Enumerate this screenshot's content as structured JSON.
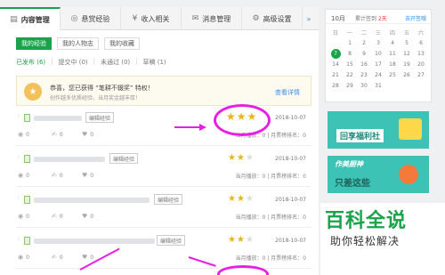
{
  "tabs": [
    {
      "label": "内容管理",
      "icon": "content-icon",
      "active": true
    },
    {
      "label": "悬赏经验",
      "icon": "bounty-icon",
      "active": false
    },
    {
      "label": "收入相关",
      "icon": "income-icon",
      "active": false
    },
    {
      "label": "消息管理",
      "icon": "message-icon",
      "active": false
    },
    {
      "label": "高级设置",
      "icon": "settings-icon",
      "active": false
    }
  ],
  "tabs_more": "»",
  "subtabs": [
    "我的经验",
    "我的人物志",
    "我的收藏"
  ],
  "filters": {
    "published": "已发布 (6)",
    "submitted": "提交中 (0)",
    "rejected": "未通过 (0)",
    "drafts": "草稿 (1)"
  },
  "notice": {
    "title": "恭喜，您已获得 “笔耕不辍奖” 特权！",
    "subtitle": "创作越多优质经验，当月奖金越丰厚！",
    "link": "查看详情"
  },
  "rows": [
    {
      "tag": "编辑经验",
      "stars": 3,
      "date": "2018-10-07",
      "views": "0",
      "votes": "0",
      "likes": "0",
      "rank": "当月播放：0 | 月票榜排名：0"
    },
    {
      "tag": "编辑经验",
      "stars": 2,
      "date": "2018-10-07",
      "views": "0",
      "votes": "0",
      "likes": "0",
      "rank": "当月播放：0 | 月票榜排名：0"
    },
    {
      "tag": "编辑经验",
      "stars": 2,
      "date": "2018-10-07",
      "views": "0",
      "votes": "0",
      "likes": "0",
      "rank": "当月播放：0 | 月票榜排名：0"
    },
    {
      "tag": "编辑经验",
      "stars": 2,
      "date": "2018-10-07",
      "views": "0",
      "votes": "0",
      "likes": "0",
      "rank": "当月播放：0 | 月票榜排名：0"
    }
  ],
  "calendar": {
    "month": "10月",
    "sign_label": "累计签到",
    "sign_days": "2天",
    "open_link": "去开签哦",
    "weekdays": [
      "日",
      "一",
      "二",
      "三",
      "四",
      "五",
      "六"
    ],
    "days": [
      "",
      "1",
      "2",
      "3",
      "4",
      "5",
      "6",
      "7",
      "8",
      "9",
      "10",
      "11",
      "12",
      "13",
      "14",
      "15",
      "16",
      "17",
      "18",
      "19",
      "20",
      "21",
      "22",
      "23",
      "24",
      "25",
      "26",
      "27",
      "28",
      "29",
      "30",
      "31",
      "",
      "",
      ""
    ],
    "today": "7"
  },
  "banners": {
    "welfare": "回享福利社",
    "cooking_top": "作美厨神",
    "cooking_bottom": "只差这些"
  },
  "watermark": {
    "title": "百科全说",
    "subtitle": "助你轻松解决"
  },
  "colors": {
    "accent": "#1aa34a",
    "annotation": "#e91ee5",
    "star": "#e8b516",
    "link": "#3a8ee6"
  }
}
